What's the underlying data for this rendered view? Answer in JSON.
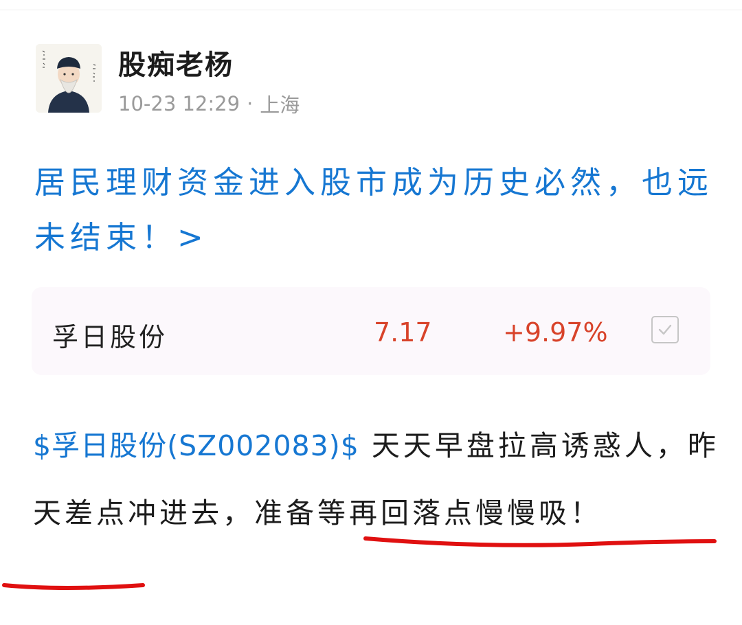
{
  "author": {
    "name": "股痴老杨"
  },
  "post": {
    "time": "10-23 12:29",
    "separator": "·",
    "location": "上海"
  },
  "headline": {
    "text": "居民理财资金进入股市成为历史必然，也远未结束！>"
  },
  "stock_card": {
    "name": "孚日股份",
    "price": "7.17",
    "change": "+9.97%",
    "checked": true
  },
  "body": {
    "stock_tag": "$孚日股份(SZ002083)$",
    "text": " 天天早盘拉高诱惑人，昨天差点冲进去，准备等再回落点慢慢吸！"
  },
  "colors": {
    "link_blue": "#1677d2",
    "price_red": "#d8432a",
    "annotation_red": "#e01010"
  },
  "icons": {
    "checkbox": "checkmark-icon"
  }
}
